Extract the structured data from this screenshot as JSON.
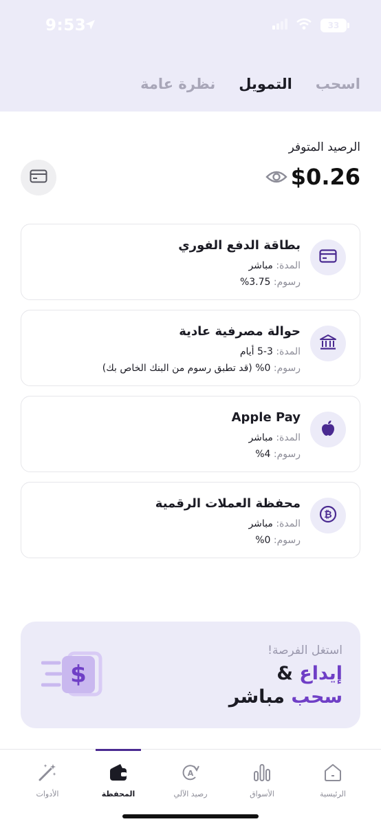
{
  "status_bar": {
    "time": "9:53",
    "battery": "33"
  },
  "tabs": [
    {
      "label": "نظرة عامة",
      "active": false
    },
    {
      "label": "التمويل",
      "active": true
    },
    {
      "label": "اسحب",
      "active": false
    }
  ],
  "balance": {
    "label": "الرصيد المتوفر",
    "amount": "$0.26"
  },
  "methods": [
    {
      "icon": "card-icon",
      "title": "بطاقة الدفع الفوري",
      "duration_label": "المدة:",
      "duration": "مباشر",
      "fee_label": "رسوم:",
      "fee": "3.75%"
    },
    {
      "icon": "bank-icon",
      "title": "حوالة مصرفية عادية",
      "duration_label": "المدة:",
      "duration": "3-5 أيام",
      "fee_label": "رسوم:",
      "fee": "0% (قد تطبق رسوم من البنك الخاص بك)"
    },
    {
      "icon": "apple-icon",
      "title": "Apple Pay",
      "duration_label": "المدة:",
      "duration": "مباشر",
      "fee_label": "رسوم:",
      "fee": "4%"
    },
    {
      "icon": "bitcoin-icon",
      "title": "محفظة العملات الرقمية",
      "duration_label": "المدة:",
      "duration": "مباشر",
      "fee_label": "رسوم:",
      "fee": "0%"
    }
  ],
  "promo": {
    "subtitle": "استغل الفرصة!",
    "line1_purple": "إيداع",
    "line1_dark": " &",
    "line2_purple": "سحب",
    "line2_dark": " مباشر"
  },
  "bottom_nav": [
    {
      "label": "الرئيسية",
      "icon": "home-icon",
      "active": false
    },
    {
      "label": "الأسواق",
      "icon": "markets-icon",
      "active": false
    },
    {
      "label": "رصيد الآلي",
      "icon": "auto-balance-icon",
      "active": false
    },
    {
      "label": "المحفظة",
      "icon": "wallet-icon",
      "active": true
    },
    {
      "label": "الأدوات",
      "icon": "tools-icon",
      "active": false
    }
  ],
  "colors": {
    "accent": "#6f3fc6",
    "header_bg": "#ecebf8",
    "icon_purple": "#4a2a91"
  }
}
